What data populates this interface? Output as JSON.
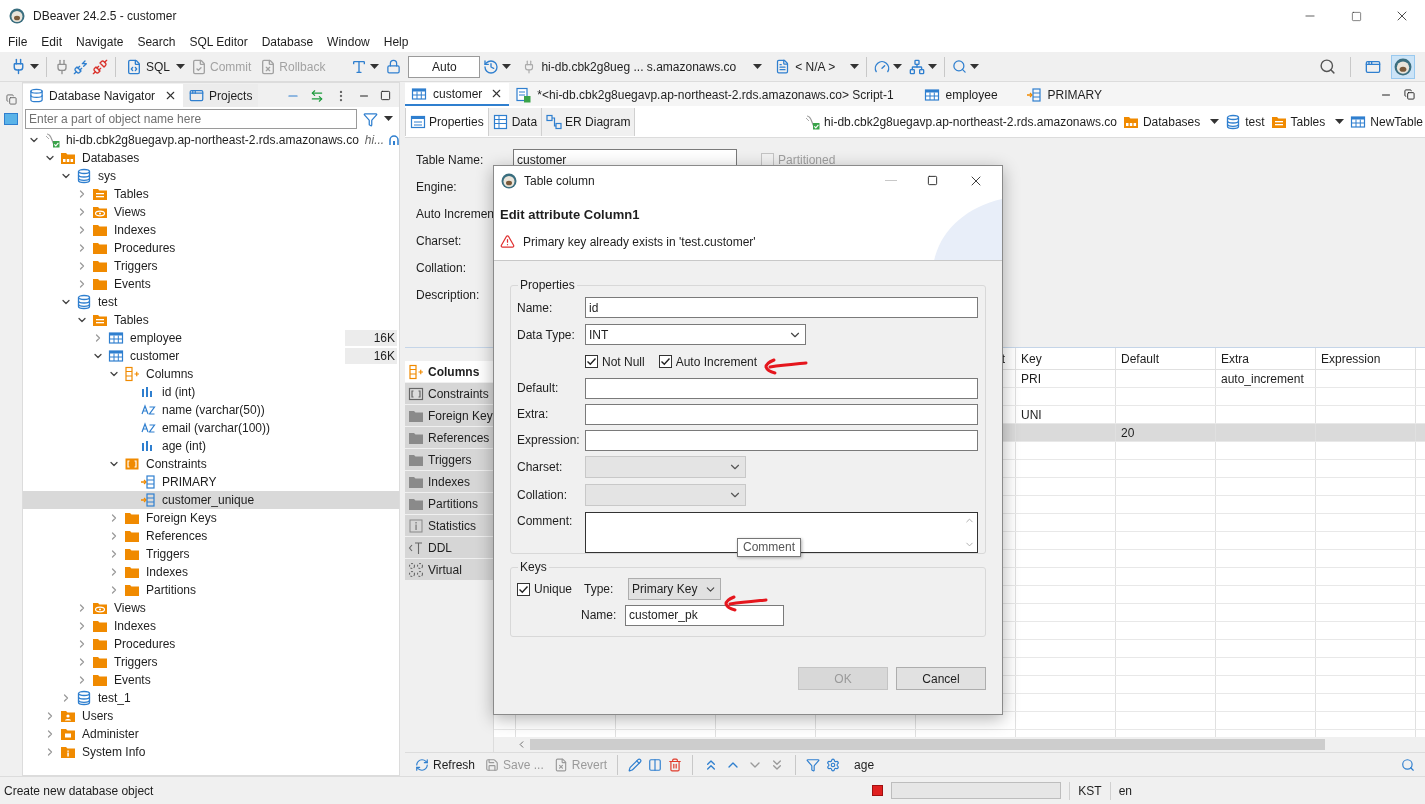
{
  "window": {
    "title": "DBeaver 24.2.5 - customer"
  },
  "menu": [
    "File",
    "Edit",
    "Navigate",
    "Search",
    "SQL Editor",
    "Database",
    "Window",
    "Help"
  ],
  "toolbar": {
    "sql": "SQL",
    "commit": {
      "label": "Commit",
      "disabled": true
    },
    "rollback": {
      "label": "Rollback",
      "disabled": true
    },
    "mode": "Auto",
    "connection": "hi-db.cbk2g8ueg ... s.amazonaws.co",
    "schema": "< N/A >"
  },
  "navigator": {
    "tabs": [
      {
        "label": "Database Navigator",
        "selected": true
      },
      {
        "label": "Projects",
        "selected": false
      }
    ],
    "filter": {
      "placeholder": "Enter a part of object name here"
    },
    "tree": [
      {
        "label": "hi-db.cbk2g8uegavp.ap-northeast-2.rds.amazonaws.co",
        "suffix": "hi...",
        "kind": "connection",
        "expanded": true,
        "selected": false,
        "children": [
          {
            "label": "Databases",
            "kind": "databases",
            "expanded": true,
            "selected": false,
            "children": [
              {
                "label": "sys",
                "kind": "db",
                "expanded": true,
                "selected": false,
                "children": [
                  {
                    "label": "Tables",
                    "kind": "tables",
                    "expanded": false,
                    "selected": false
                  },
                  {
                    "label": "Views",
                    "kind": "views",
                    "expanded": false,
                    "selected": false
                  },
                  {
                    "label": "Indexes",
                    "kind": "folder",
                    "expanded": false,
                    "selected": false
                  },
                  {
                    "label": "Procedures",
                    "kind": "folder",
                    "expanded": false,
                    "selected": false
                  },
                  {
                    "label": "Triggers",
                    "kind": "folder",
                    "expanded": false,
                    "selected": false
                  },
                  {
                    "label": "Events",
                    "kind": "folder",
                    "expanded": false,
                    "selected": false
                  }
                ]
              },
              {
                "label": "test",
                "kind": "db",
                "expanded": true,
                "selected": false,
                "children": [
                  {
                    "label": "Tables",
                    "kind": "tables",
                    "expanded": true,
                    "selected": false,
                    "children": [
                      {
                        "label": "employee",
                        "kind": "table",
                        "expanded": false,
                        "selected": false,
                        "size": "16K"
                      },
                      {
                        "label": "customer",
                        "kind": "table",
                        "expanded": true,
                        "selected": false,
                        "size": "16K",
                        "children": [
                          {
                            "label": "Columns",
                            "kind": "columns",
                            "expanded": true,
                            "selected": false,
                            "children": [
                              {
                                "label": "id (int)",
                                "kind": "num",
                                "selected": false
                              },
                              {
                                "label": "name (varchar(50))",
                                "kind": "str",
                                "selected": false
                              },
                              {
                                "label": "email (varchar(100))",
                                "kind": "str",
                                "selected": false
                              },
                              {
                                "label": "age (int)",
                                "kind": "num",
                                "selected": false
                              }
                            ]
                          },
                          {
                            "label": "Constraints",
                            "kind": "constraints",
                            "expanded": true,
                            "selected": false,
                            "children": [
                              {
                                "label": "PRIMARY",
                                "kind": "key",
                                "selected": false
                              },
                              {
                                "label": "customer_unique",
                                "kind": "key",
                                "selected": true
                              }
                            ]
                          },
                          {
                            "label": "Foreign Keys",
                            "kind": "folder",
                            "expanded": false,
                            "selected": false
                          },
                          {
                            "label": "References",
                            "kind": "folder",
                            "expanded": false,
                            "selected": false
                          },
                          {
                            "label": "Triggers",
                            "kind": "folder",
                            "expanded": false,
                            "selected": false
                          },
                          {
                            "label": "Indexes",
                            "kind": "folder",
                            "expanded": false,
                            "selected": false
                          },
                          {
                            "label": "Partitions",
                            "kind": "folder",
                            "expanded": false,
                            "selected": false
                          }
                        ]
                      }
                    ]
                  },
                  {
                    "label": "Views",
                    "kind": "views",
                    "expanded": false,
                    "selected": false
                  },
                  {
                    "label": "Indexes",
                    "kind": "folder",
                    "expanded": false,
                    "selected": false
                  },
                  {
                    "label": "Procedures",
                    "kind": "folder",
                    "expanded": false,
                    "selected": false
                  },
                  {
                    "label": "Triggers",
                    "kind": "folder",
                    "expanded": false,
                    "selected": false
                  },
                  {
                    "label": "Events",
                    "kind": "folder",
                    "expanded": false,
                    "selected": false
                  }
                ]
              },
              {
                "label": "test_1",
                "kind": "db",
                "expanded": false,
                "selected": false
              }
            ]
          },
          {
            "label": "Users",
            "kind": "users",
            "expanded": false,
            "selected": false
          },
          {
            "label": "Administer",
            "kind": "admin",
            "expanded": false,
            "selected": false
          },
          {
            "label": "System Info",
            "kind": "info",
            "expanded": false,
            "selected": false
          }
        ]
      }
    ]
  },
  "editor": {
    "tabs": [
      {
        "label": "customer",
        "kind": "table",
        "selected": true
      },
      {
        "label": "*<hi-db.cbk2g8uegavp.ap-northeast-2.rds.amazonaws.co> Script-1",
        "kind": "script",
        "selected": false
      },
      {
        "label": "employee",
        "kind": "table",
        "selected": false
      },
      {
        "label": "PRIMARY",
        "kind": "key",
        "selected": false
      }
    ],
    "subtabs": [
      {
        "label": "Properties",
        "kind": "props",
        "selected": true
      },
      {
        "label": "Data",
        "kind": "data",
        "selected": false
      },
      {
        "label": "ER Diagram",
        "kind": "er",
        "selected": false
      }
    ],
    "breadcrumb": [
      {
        "label": "hi-db.cbk2g8uegavp.ap-northeast-2.rds.amazonaws.co",
        "kind": "connection",
        "dropdown": false
      },
      {
        "label": "Databases",
        "kind": "databases",
        "dropdown": true
      },
      {
        "label": "test",
        "kind": "db",
        "dropdown": false
      },
      {
        "label": "Tables",
        "kind": "tables",
        "dropdown": true
      },
      {
        "label": "NewTable",
        "kind": "table",
        "dropdown": false
      }
    ],
    "form": [
      {
        "label": "Table Name:",
        "value": "customer"
      },
      {
        "label": "Engine:"
      },
      {
        "label": "Auto Incremen"
      },
      {
        "label": "Charset:"
      },
      {
        "label": "Collation:"
      },
      {
        "label": "Description:"
      }
    ],
    "partitioned": {
      "label": "Partitioned",
      "checked": false,
      "disabled": true
    },
    "side_tabs": [
      {
        "label": "Columns",
        "kind": "columns",
        "selected": true
      },
      {
        "label": "Constraints",
        "kind": "constraints",
        "selected": false
      },
      {
        "label": "Foreign Key",
        "kind": "folder",
        "selected": false
      },
      {
        "label": "References",
        "kind": "folder",
        "selected": false
      },
      {
        "label": "Triggers",
        "kind": "folder",
        "selected": false
      },
      {
        "label": "Indexes",
        "kind": "folder",
        "selected": false
      },
      {
        "label": "Partitions",
        "kind": "folder",
        "selected": false
      },
      {
        "label": "Statistics",
        "kind": "info",
        "selected": false
      },
      {
        "label": "DDL",
        "kind": "ddl",
        "selected": false
      },
      {
        "label": "Virtual",
        "kind": "virtual",
        "selected": false
      }
    ],
    "grid": {
      "columns": [
        "t",
        "Key",
        "Default",
        "Extra",
        "Expression"
      ],
      "rows": [
        {
          "key": "PRI",
          "extra": "auto_increment",
          "selected": false
        },
        {
          "selected": false
        },
        {
          "key": "UNI",
          "selected": false
        },
        {
          "default": "20",
          "selected": true
        }
      ]
    },
    "bottom_toolbar": {
      "refresh": {
        "label": "Refresh",
        "disabled": false
      },
      "save": {
        "label": "Save ...",
        "disabled": true
      },
      "revert": {
        "label": "Revert",
        "disabled": true
      },
      "filter": "age"
    }
  },
  "dialog": {
    "title": "Table column",
    "heading": "Edit attribute Column1",
    "message": "Primary key already exists in 'test.customer'",
    "properties": {
      "title": "Properties",
      "name": {
        "label": "Name:",
        "value": "id"
      },
      "data_type": {
        "label": "Data Type:",
        "value": "INT"
      },
      "not_null": {
        "label": "Not Null",
        "checked": true
      },
      "auto_increment": {
        "label": "Auto Increment",
        "checked": true
      },
      "default": {
        "label": "Default:"
      },
      "extra": {
        "label": "Extra:"
      },
      "expression": {
        "label": "Expression:"
      },
      "charset": {
        "label": "Charset:",
        "disabled": true
      },
      "collation": {
        "label": "Collation:",
        "disabled": true
      },
      "comment": {
        "label": "Comment:"
      }
    },
    "tooltip": "Comment",
    "keys": {
      "title": "Keys",
      "unique": {
        "label": "Unique",
        "checked": true
      },
      "type": {
        "label": "Type:",
        "value": "Primary Key"
      },
      "name": {
        "label": "Name:",
        "value": "customer_pk"
      }
    },
    "buttons": [
      {
        "label": "OK",
        "disabled": true
      },
      {
        "label": "Cancel",
        "disabled": false
      }
    ]
  },
  "status_bar": {
    "message": "Create new database object",
    "timezone": "KST",
    "locale": "en"
  }
}
